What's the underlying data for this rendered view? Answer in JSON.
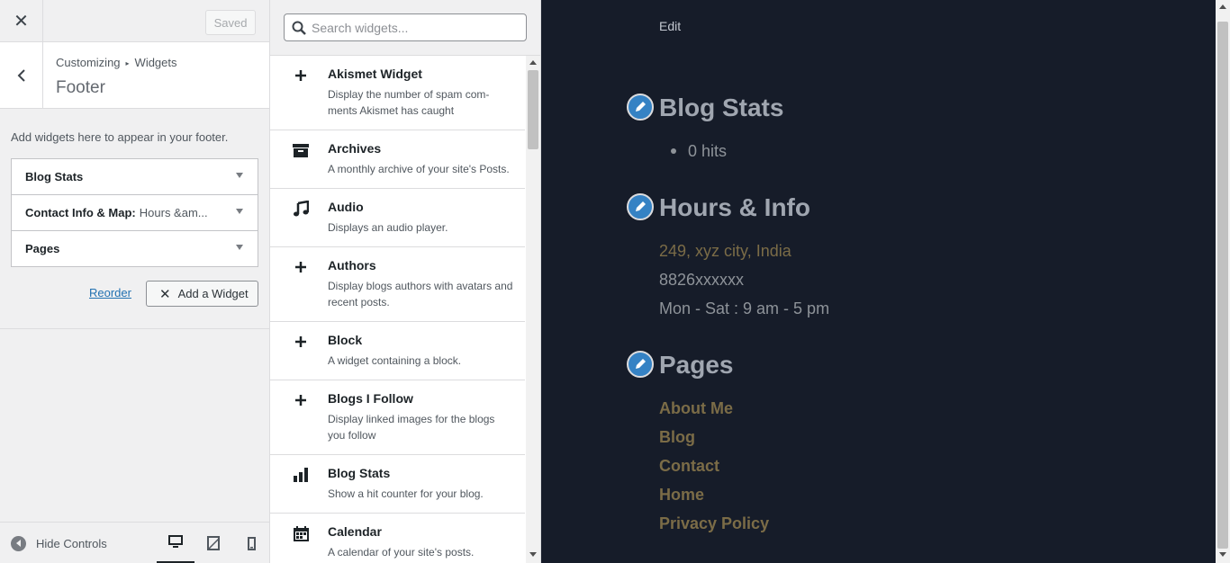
{
  "header": {
    "close_label": "✕",
    "saved_label": "Saved"
  },
  "section": {
    "breadcrumb_parent": "Customizing",
    "breadcrumb_child": "Widgets",
    "title": "Footer",
    "description": "Add widgets here to appear in your footer."
  },
  "area_widgets": [
    {
      "name": "Blog Stats",
      "sub": ""
    },
    {
      "name": "Contact Info & Map:",
      "sub": "Hours &am..."
    },
    {
      "name": "Pages",
      "sub": ""
    }
  ],
  "actions": {
    "reorder_label": "Reorder",
    "add_widget_label": "Add a Widget"
  },
  "footer": {
    "hide_controls_label": "Hide Controls",
    "devices": [
      "desktop",
      "tablet",
      "mobile"
    ],
    "active_device": "desktop"
  },
  "search": {
    "placeholder": "Search widgets..."
  },
  "available_widgets": [
    {
      "icon": "plus-icon",
      "title": "Akismet Widget",
      "desc": "Display the number of spam com-ments Akismet has caught"
    },
    {
      "icon": "archive-icon",
      "title": "Archives",
      "desc": "A monthly archive of your site's Posts."
    },
    {
      "icon": "music-note-icon",
      "title": "Audio",
      "desc": "Displays an audio player."
    },
    {
      "icon": "plus-icon",
      "title": "Authors",
      "desc": "Display blogs authors with avatars and recent posts."
    },
    {
      "icon": "plus-icon",
      "title": "Block",
      "desc": "A widget containing a block."
    },
    {
      "icon": "plus-icon",
      "title": "Blogs I Follow",
      "desc": "Display linked images for the blogs you follow"
    },
    {
      "icon": "bar-chart-icon",
      "title": "Blog Stats",
      "desc": "Show a hit counter for your blog."
    },
    {
      "icon": "calendar-icon",
      "title": "Calendar",
      "desc": "A calendar of your site's posts."
    }
  ],
  "preview": {
    "edit_label": "Edit",
    "blog_stats_title": "Blog Stats",
    "hits": "0 hits",
    "hours_title": "Hours & Info",
    "address": "249, xyz city, India",
    "phone": "8826xxxxxx",
    "hours": "Mon - Sat : 9 am - 5 pm",
    "pages_title": "Pages",
    "pages": [
      "About Me",
      "Blog",
      "Contact",
      "Home",
      "Privacy Policy"
    ]
  },
  "colors": {
    "accent": "#2271b1",
    "preview_bg": "#161c29",
    "edit_pencil": "#3582c4",
    "page_link": "#7b6c47",
    "address_text": "#7b6c47"
  }
}
